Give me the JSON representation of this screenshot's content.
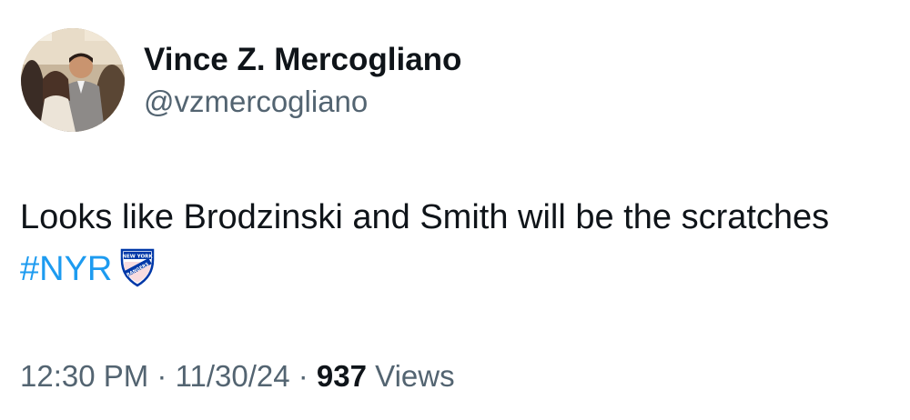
{
  "author": {
    "display_name": "Vince Z. Mercogliano",
    "handle": "@vzmercogliano",
    "avatar_icon": "profile-photo"
  },
  "tweet": {
    "text": "Looks like Brodzinski and Smith will be the scratches ",
    "hashtag": "#NYR",
    "emoji_icon": "new-york-rangers-logo",
    "emoji_text_line1": "NEW YORK",
    "emoji_text_line2": "RANGERS"
  },
  "meta": {
    "time": "12:30 PM",
    "separator": " · ",
    "date": "11/30/24",
    "views_count": "937",
    "views_label": " Views"
  },
  "colors": {
    "text": "#0f1419",
    "secondary": "#536471",
    "link": "#1d9bf0",
    "rangers_blue": "#0038a8",
    "rangers_red": "#ce1126"
  }
}
